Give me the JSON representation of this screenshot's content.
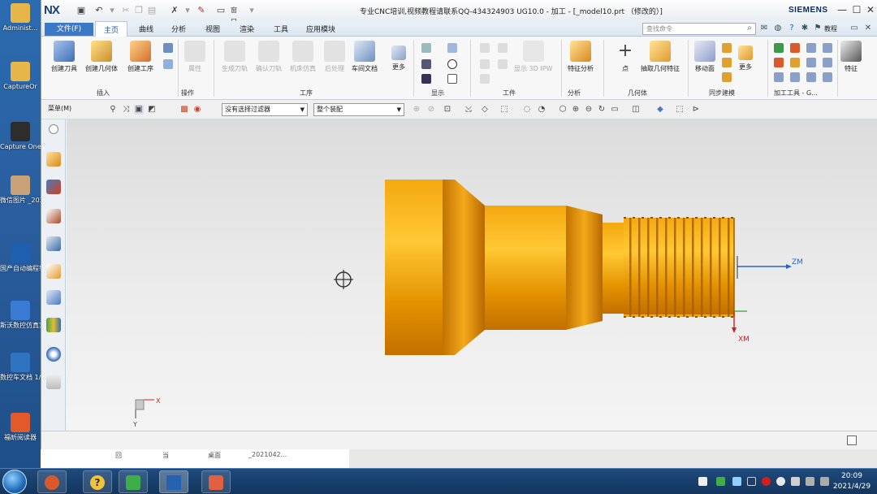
{
  "desktop": {
    "icons": [
      {
        "label": "Administ...",
        "color": "#e7b64a"
      },
      {
        "label": "CaptureOr",
        "color": "#e7b64a"
      },
      {
        "label": "Capture One 12",
        "color": "#2d2d2d"
      },
      {
        "label": "微信图片 _2021042..",
        "color": "#c9a27a"
      },
      {
        "label": "国产自动编程软件应...",
        "color": "#1e5fb0"
      },
      {
        "label": "斯沃数控仿真实操之...",
        "color": "#3a7bd5"
      },
      {
        "label": "数控车文档 1/th",
        "color": "#2f74c0"
      },
      {
        "label": "福昕阅读器",
        "color": "#e35a2a"
      }
    ]
  },
  "window": {
    "logo": "NX",
    "title": "专业CNC培训,视频教程请联系QQ-434324903 UG10.0 - 加工 - [_model10.prt （修改的）]",
    "brand": "SIEMENS",
    "controls": {
      "minimize": "—",
      "maximize": "☐",
      "close": "✕"
    }
  },
  "menubar": {
    "file_menu": "文件(F)",
    "tabs": [
      "主页",
      "曲线",
      "分析",
      "视图",
      "渲染",
      "工具",
      "应用模块"
    ],
    "active_tab": "主页",
    "search_placeholder": "查找命令",
    "help_label": "教程"
  },
  "ribbon": {
    "buttons": [
      {
        "label": "创建刀具",
        "color": "#5a7fb8",
        "dim": false
      },
      {
        "label": "创建几何体",
        "color": "#c9a34a",
        "dim": false
      },
      {
        "label": "创建工序",
        "color": "#d08a2a",
        "dim": false
      },
      {
        "label": "属性",
        "color": "#d9d9d9",
        "dim": true
      },
      {
        "label": "生成刀轨",
        "color": "#d9d9d9",
        "dim": true
      },
      {
        "label": "确认刀轨",
        "color": "#d9d9d9",
        "dim": true
      },
      {
        "label": "机床仿真",
        "color": "#d9d9d9",
        "dim": true
      },
      {
        "label": "后处理",
        "color": "#d9d9d9",
        "dim": true
      },
      {
        "label": "车间文档",
        "color": "#6d8fbf",
        "dim": false
      },
      {
        "label": "更多",
        "color": "#8aa0c8",
        "dim": false
      },
      {
        "label": "显示 3D IPW",
        "color": "#d9d9d9",
        "dim": true
      },
      {
        "label": "特征分析",
        "color": "#e0a030",
        "dim": false
      },
      {
        "label": "点",
        "color": "#ffffff",
        "dim": false
      },
      {
        "label": "抽取几何特征",
        "color": "#f0b040",
        "dim": false
      },
      {
        "label": "移动面",
        "color": "#b0b8d8",
        "dim": false
      },
      {
        "label": "更多",
        "color": "#e0a030",
        "dim": false
      },
      {
        "label": "特征",
        "color": "#5a9ad0",
        "dim": false
      }
    ],
    "groups": [
      "插入",
      "操作",
      "工序",
      "显示",
      "工件",
      "分析",
      "几何体",
      "同步建模",
      "加工工具 - G..."
    ]
  },
  "toolbar2": {
    "menu_label": "菜单(M)",
    "filter_dropdown": "没有选择过滤器",
    "scope_dropdown": "整个装配"
  },
  "viewport": {
    "wcs_labels": {
      "zm": "ZM",
      "xm": "XM"
    },
    "triad_labels": {
      "x": "X",
      "y": "Y"
    }
  },
  "bg_window": {
    "items": [
      "回",
      "当",
      "桌面",
      "_2021042..."
    ]
  },
  "taskbar": {
    "apps": [
      {
        "name": "browser",
        "color": "#d85a2a"
      },
      {
        "name": "help",
        "color": "#f2c23a"
      },
      {
        "name": "camtasia",
        "color": "#3fae49"
      },
      {
        "name": "nx",
        "color": "#2563b0"
      },
      {
        "name": "powerpoint",
        "color": "#e06040"
      }
    ],
    "time": "20:09",
    "date": "2021/4/29"
  }
}
